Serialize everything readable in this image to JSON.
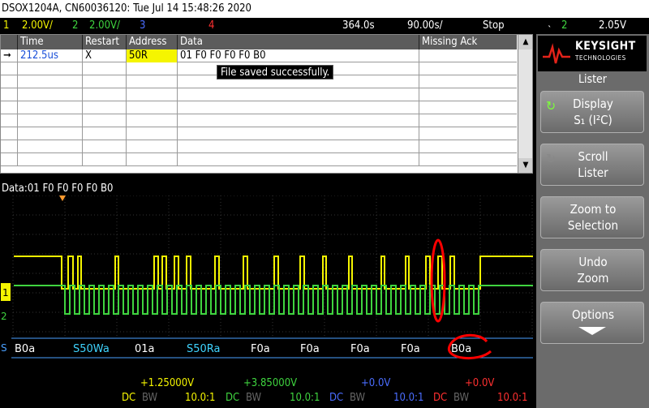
{
  "title_bar": "DSOX1204A, CN60036120: Tue Jul 14 15:48:26 2020",
  "status": {
    "ch1_num": "1",
    "ch1_scale": "2.00V/",
    "ch2_num": "2",
    "ch2_scale": "2.00V/",
    "ch3_num": "3",
    "ch4_num": "4",
    "timebase": "364.0s",
    "time_per_div": "90.00s/",
    "run_state": "Stop",
    "trig_num": "2",
    "trig_level": "2.05V"
  },
  "lister": {
    "columns": [
      "Time",
      "Restart",
      "Address",
      "Data",
      "Missing Ack"
    ],
    "rows": [
      {
        "time": "212.5us",
        "restart": "X",
        "address": "50R",
        "data": "01  F0  F0  F0  F0  B0",
        "missing_ack": ""
      }
    ],
    "empty_row_count": 8,
    "tooltip": "File saved successfully."
  },
  "data_line": "Data:01  F0  F0  F0  F0  B0",
  "decode_labels": [
    "B0a",
    "S50Wa",
    "01a",
    "S50Ra",
    "F0a",
    "F0a",
    "F0a",
    "F0a",
    "B0a"
  ],
  "channel_markers": {
    "ch1": "1",
    "ch2": "2",
    "serial": "S"
  },
  "bottom": {
    "ch1_offset": "+1.25000V",
    "ch2_offset": "+3.85000V",
    "ch3_offset": "+0.0V",
    "ch4_offset": "+0.0V",
    "ch1_coupling": "DC",
    "ch1_bw": "BW",
    "ch1_probe": "10.0:1",
    "ch2_coupling": "DC",
    "ch2_bw": "BW",
    "ch2_probe": "10.0:1",
    "ch3_coupling": "DC",
    "ch3_bw": "BW",
    "ch3_probe": "10.0:1",
    "ch4_coupling": "DC",
    "ch4_bw": "BW",
    "ch4_probe": "10.0:1"
  },
  "panel": {
    "brand": "KEYSIGHT",
    "brand_sub": "TECHNOLOGIES",
    "title": "Lister",
    "softkeys": [
      {
        "line1": "Display",
        "line2": "S₁ (I²C)"
      },
      {
        "line1": "Scroll",
        "line2": "Lister"
      },
      {
        "line1": "Zoom to",
        "line2": "Selection"
      },
      {
        "line1": "Undo",
        "line2": "Zoom"
      },
      {
        "line1": "Options",
        "line2": ""
      }
    ]
  },
  "colors": {
    "ch1": "#f5f500",
    "ch2": "#3fd43f",
    "ch3": "#4a6dff",
    "ch4": "#ff3030",
    "annotation": "#ff0000"
  }
}
